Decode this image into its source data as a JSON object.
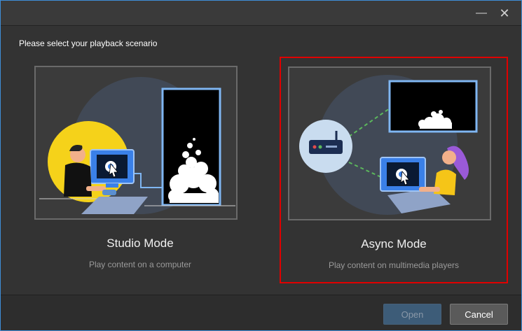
{
  "window": {
    "minimize_glyph": "—",
    "close_glyph": "✕"
  },
  "prompt": "Please select your playback scenario",
  "modes": [
    {
      "title": "Studio Mode",
      "subtitle": "Play content on a computer"
    },
    {
      "title": "Async Mode",
      "subtitle": "Play content on multimedia players"
    }
  ],
  "selected_mode": "Async Mode",
  "buttons": {
    "open": "Open",
    "cancel": "Cancel"
  },
  "colors": {
    "selection_border": "#e00000",
    "accent_blue": "#7fb6f2",
    "sun_yellow": "#f5d21a",
    "figure_purple": "#9a5ad8"
  },
  "icons": [
    "minimize-icon",
    "close-icon",
    "cursor-icon",
    "router-icon"
  ]
}
